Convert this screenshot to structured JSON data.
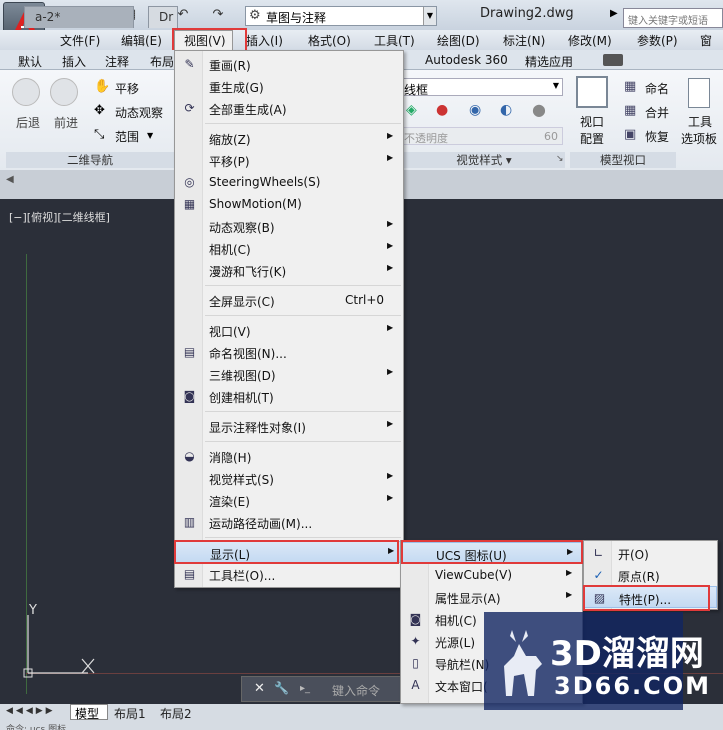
{
  "titlebar": {
    "workspace": "草图与注释",
    "doc_title": "Drawing2.dwg",
    "search_placeholder": "键入关键字或短语"
  },
  "menubar": [
    "文件(F)",
    "编辑(E)",
    "视图(V)",
    "插入(I)",
    "格式(O)",
    "工具(T)",
    "绘图(D)",
    "标注(N)",
    "修改(M)",
    "参数(P)",
    "窗口"
  ],
  "ribbon_tabs": [
    "默认",
    "插入",
    "注释",
    "布局",
    "Autodesk 360",
    "精选应用"
  ],
  "ribbon": {
    "back": "后退",
    "forward": "前进",
    "pan": "平移",
    "orbit": "动态观察",
    "extents": "范围",
    "panel_nav": "二维导航",
    "visual_style": "线框",
    "opacity_label": "不透明度",
    "opacity_value": "60",
    "panel_visual": "视觉样式",
    "viewport_config_1": "视口",
    "viewport_config_2": "配置",
    "named": "命名",
    "merge": "合并",
    "restore": "恢复",
    "panel_model_viewport": "模型视口",
    "tools_1": "工具",
    "tools_2": "选项板"
  },
  "doc_tabs": [
    "a-2*",
    "Dr"
  ],
  "viewport_label": "[−][俯视][二维线框]",
  "ucs": {
    "y": "Y",
    "x": "X"
  },
  "command": {
    "placeholder": "键入命令"
  },
  "layout_tabs": [
    "模型",
    "布局1",
    "布局2"
  ],
  "status_text": "命令: ucs 图标...",
  "view_menu": [
    {
      "label": "重画(R)",
      "icon": "pencil-icon"
    },
    {
      "label": "重生成(G)"
    },
    {
      "label": "全部重生成(A)",
      "icon": "regen-all-icon"
    },
    {
      "sep": true
    },
    {
      "label": "缩放(Z)",
      "sub": true
    },
    {
      "label": "平移(P)",
      "sub": true
    },
    {
      "label": "SteeringWheels(S)",
      "icon": "steering-wheel-icon"
    },
    {
      "label": "ShowMotion(M)",
      "icon": "showmotion-icon"
    },
    {
      "label": "动态观察(B)",
      "sub": true
    },
    {
      "label": "相机(C)",
      "sub": true
    },
    {
      "label": "漫游和飞行(K)",
      "sub": true
    },
    {
      "sep": true
    },
    {
      "label": "全屏显示(C)",
      "shortcut": "Ctrl+0"
    },
    {
      "sep": true
    },
    {
      "label": "视口(V)",
      "sub": true
    },
    {
      "label": "命名视图(N)...",
      "icon": "named-view-icon"
    },
    {
      "label": "三维视图(D)",
      "sub": true
    },
    {
      "label": "创建相机(T)",
      "icon": "camera-icon"
    },
    {
      "sep": true
    },
    {
      "label": "显示注释性对象(I)",
      "sub": true
    },
    {
      "sep": true
    },
    {
      "label": "消隐(H)",
      "icon": "hide-icon"
    },
    {
      "label": "视觉样式(S)",
      "sub": true
    },
    {
      "label": "渲染(E)",
      "sub": true
    },
    {
      "label": "运动路径动画(M)...",
      "icon": "motion-path-icon"
    },
    {
      "sep": true
    },
    {
      "label": "显示(L)",
      "sub": true,
      "active": true
    },
    {
      "label": "工具栏(O)...",
      "icon": "toolbar-icon"
    }
  ],
  "display_menu": [
    {
      "label": "UCS 图标(U)",
      "sub": true,
      "active": true
    },
    {
      "label": "ViewCube(V)",
      "sub": true
    },
    {
      "label": "属性显示(A)",
      "sub": true
    },
    {
      "label": "相机(C)",
      "icon": "camera-icon"
    },
    {
      "label": "光源(L)",
      "icon": "light-icon"
    },
    {
      "label": "导航栏(N)",
      "icon": "navbar-icon"
    },
    {
      "label": "文本窗口(",
      "icon": "text-window-icon"
    }
  ],
  "ucs_menu": [
    {
      "label": "开(O)",
      "icon": "ucs-on-icon"
    },
    {
      "label": "原点(R)",
      "icon": "check-icon"
    },
    {
      "label": "特性(P)...",
      "icon": "properties-icon",
      "active": true
    }
  ],
  "watermark": {
    "title": "3D溜溜网",
    "url": "3D66.COM"
  },
  "colors": {
    "highlight_border": "#e03a3a",
    "menu_bg": "#f0f0f0",
    "viewport_bg": "#2b2f39"
  }
}
